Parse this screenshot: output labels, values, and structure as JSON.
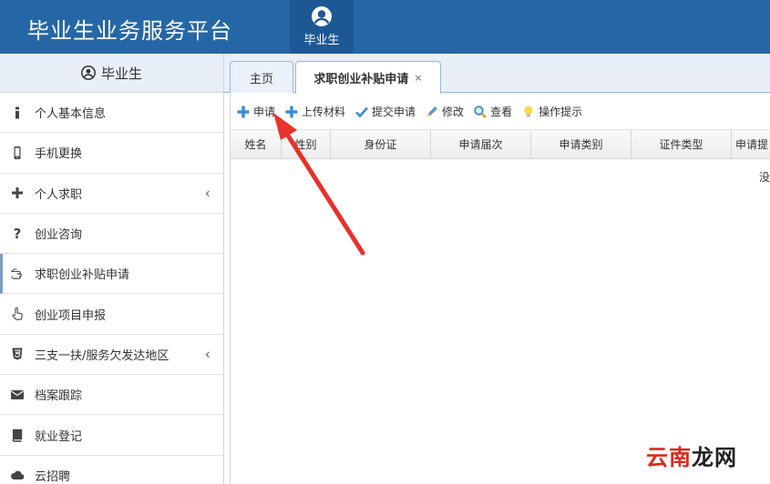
{
  "header": {
    "title": "毕业生业务服务平台",
    "user_label": "毕业生"
  },
  "sidebar": {
    "heading": "毕业生",
    "items": [
      {
        "label": "个人基本信息",
        "icon": "info-icon",
        "submenu": false
      },
      {
        "label": "手机更换",
        "icon": "mobile-icon",
        "submenu": false
      },
      {
        "label": "个人求职",
        "icon": "plus-icon",
        "submenu": true
      },
      {
        "label": "创业咨询",
        "icon": "question-icon",
        "submenu": false
      },
      {
        "label": "求职创业补贴申请",
        "icon": "hand-pointer-icon",
        "submenu": false,
        "active": true
      },
      {
        "label": "创业项目申报",
        "icon": "hand-point-up-icon",
        "submenu": false
      },
      {
        "label": "三支一扶/服务欠发达地区",
        "icon": "css3-icon",
        "submenu": true
      },
      {
        "label": "档案跟踪",
        "icon": "envelope-icon",
        "submenu": false
      },
      {
        "label": "就业登记",
        "icon": "book-icon",
        "submenu": false
      },
      {
        "label": "云招聘",
        "icon": "cloud-icon",
        "submenu": false
      }
    ]
  },
  "tabs": {
    "home": "主页",
    "active": "求职创业补贴申请",
    "close": "×"
  },
  "toolbar": {
    "apply": "申请",
    "upload": "上传材料",
    "submit": "提交申请",
    "edit": "修改",
    "view": "查看",
    "tips": "操作提示"
  },
  "grid": {
    "columns": [
      "姓名",
      "性别",
      "身份证",
      "申请届次",
      "申请类别",
      "证件类型",
      "申请提"
    ],
    "empty_message": "没"
  },
  "watermark": {
    "part1": "云南",
    "part2": "龙网"
  },
  "colors": {
    "header_bg": "#2567a6",
    "accent_red": "#e8322b",
    "tab_border": "#95b8e7"
  }
}
